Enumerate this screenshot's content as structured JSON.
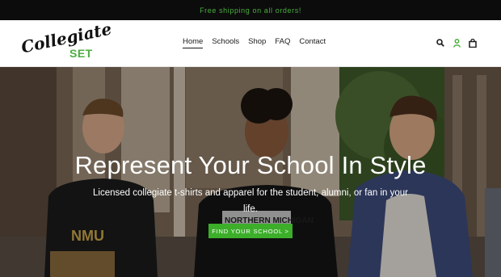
{
  "announcement": {
    "text": "Free shipping on all orders!"
  },
  "header": {
    "logo": {
      "script": "Collegiate",
      "set": "SET"
    },
    "nav": [
      {
        "label": "Home",
        "active": true
      },
      {
        "label": "Schools"
      },
      {
        "label": "Shop"
      },
      {
        "label": "FAQ"
      },
      {
        "label": "Contact"
      }
    ],
    "icons": [
      "search-icon",
      "account-icon",
      "cart-icon"
    ]
  },
  "hero": {
    "title": "Represent Your School In Style",
    "subtitle": "Licensed collegiate t-shirts and apparel for the student, alumni, or fan in your life.",
    "cta_label": "FIND YOUR SCHOOL >",
    "shirt_text_left": "NMU",
    "shirt_text_center": "NORTHERN MICHIGAN"
  },
  "colors": {
    "accent": "#4cae3f",
    "cta": "#3cae2a",
    "announce_bg": "#0c0c0c"
  }
}
